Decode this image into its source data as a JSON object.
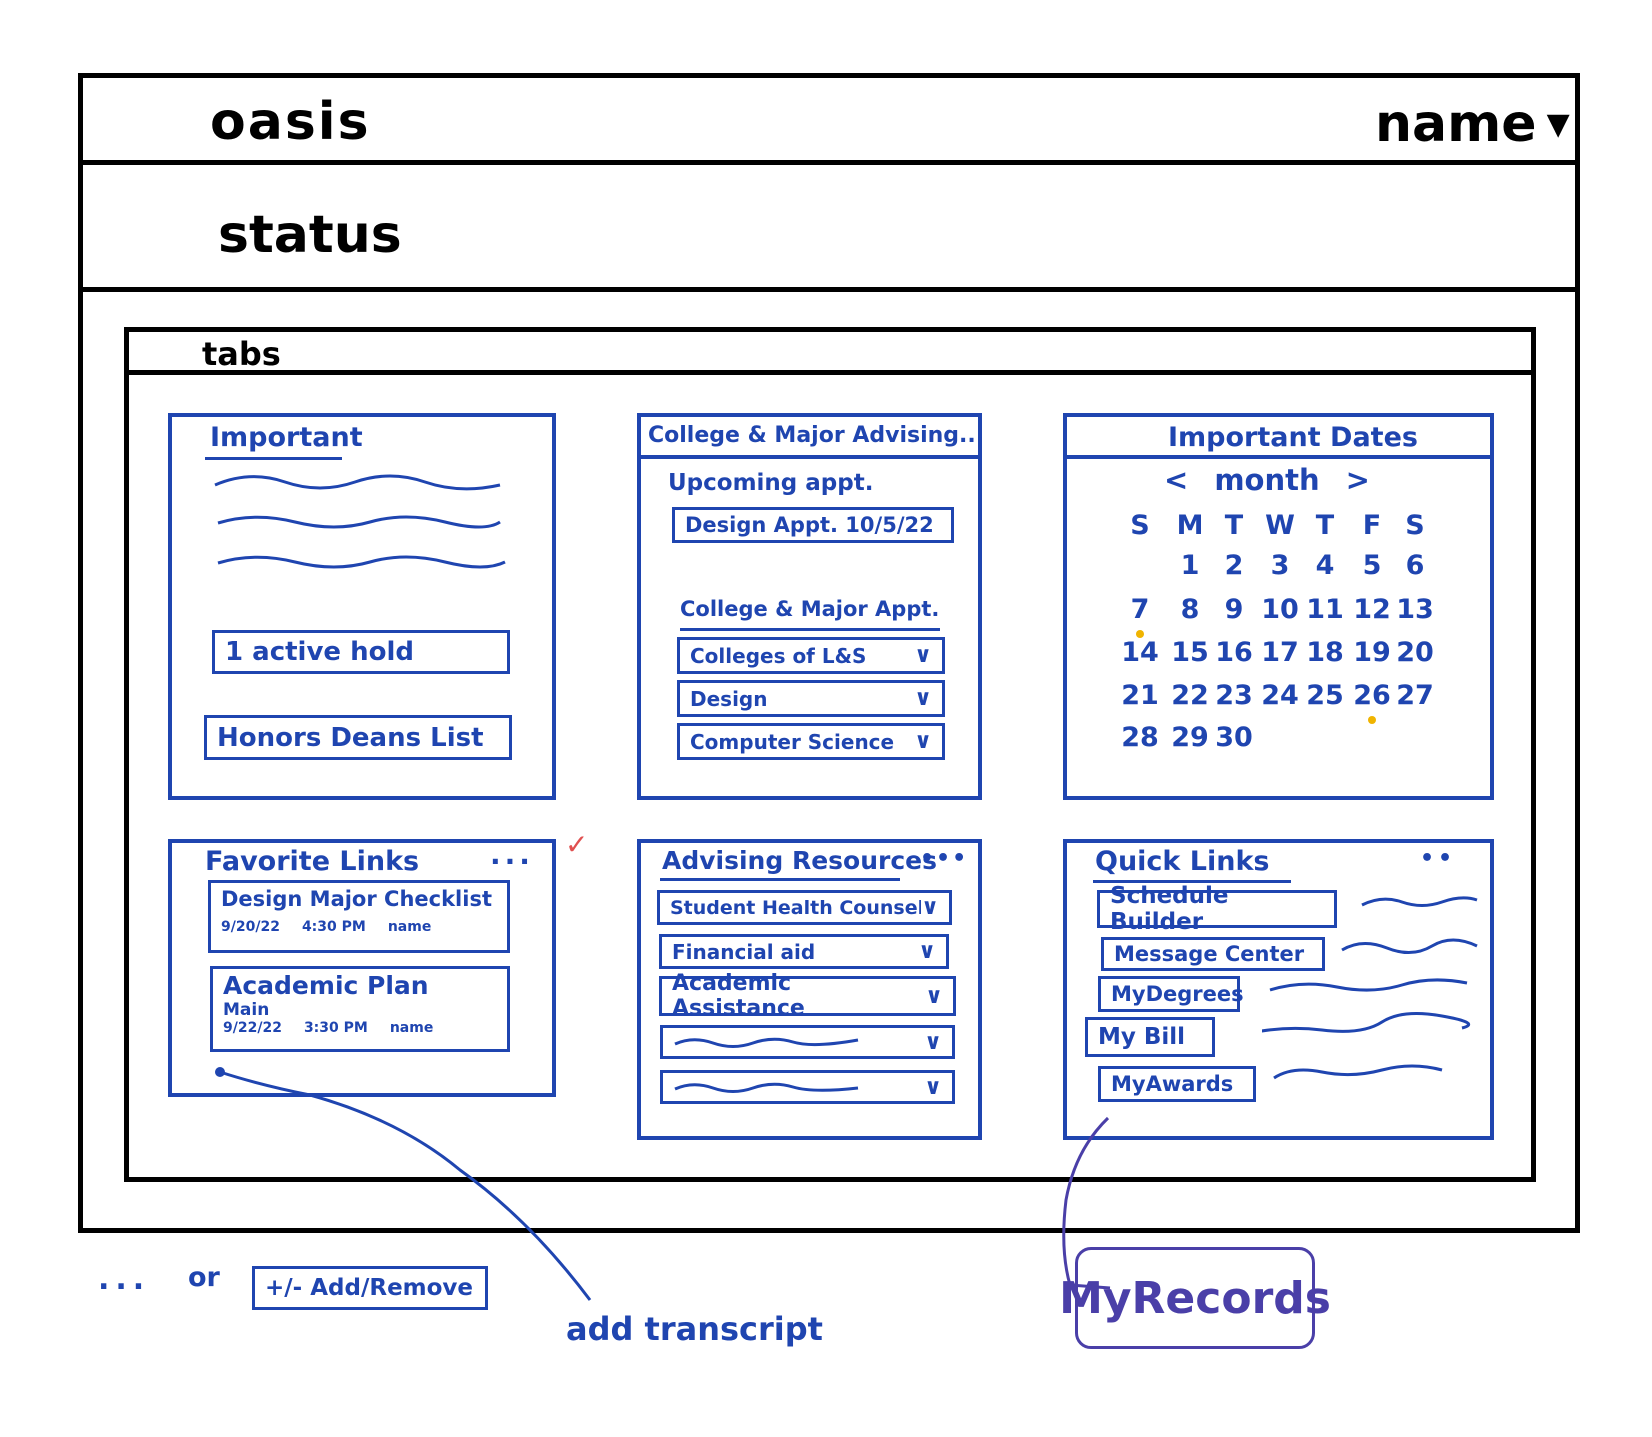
{
  "app": {
    "title": "oasis",
    "user_menu": "name"
  },
  "page": {
    "heading": "status",
    "tabs_label": "tabs"
  },
  "important": {
    "title": "Important",
    "items": [
      "1 active hold",
      "Honors Deans List"
    ]
  },
  "advising": {
    "title": "College & Major Advising...",
    "upcoming_label": "Upcoming appt.",
    "upcoming_appt": "Design Appt. 10/5/22",
    "appt_label": "College & Major Appt.",
    "options": [
      "Colleges of L&S",
      "Design",
      "Computer Science"
    ]
  },
  "dates": {
    "title": "Important Dates",
    "month_label": "month",
    "prev": "<",
    "next": ">",
    "weekdays": [
      "S",
      "M",
      "T",
      "W",
      "T",
      "F",
      "S"
    ],
    "weeks": [
      [
        "",
        "1",
        "2",
        "3",
        "4",
        "5",
        "6"
      ],
      [
        "7",
        "8",
        "9",
        "10",
        "11",
        "12",
        "13"
      ],
      [
        "14",
        "15",
        "16",
        "17",
        "18",
        "19",
        "20"
      ],
      [
        "21",
        "22",
        "23",
        "24",
        "25",
        "26",
        "27"
      ],
      [
        "28",
        "29",
        "30",
        "",
        "",
        "",
        ""
      ]
    ],
    "marked_days": [
      "7",
      "26"
    ],
    "marker_color": "#f0b400"
  },
  "favorites": {
    "title": "Favorite Links",
    "more": "...",
    "items": [
      {
        "title": "Design Major Checklist",
        "sub": "",
        "date": "9/20/22",
        "time": "4:30 PM",
        "author": "name"
      },
      {
        "title": "Academic Plan",
        "sub": "Main",
        "date": "9/22/22",
        "time": "3:30 PM",
        "author": "name"
      }
    ],
    "check_mark": "✓",
    "check_color": "#e05050"
  },
  "resources": {
    "title": "Advising Resources",
    "more": "•••",
    "items": [
      "Student Health Counseling",
      "Financial aid",
      "Academic Assistance",
      "",
      ""
    ]
  },
  "quick": {
    "title": "Quick Links",
    "more": "••",
    "items": [
      "Schedule Builder",
      "Message Center",
      "MyDegrees",
      "My Bill",
      "MyAwards"
    ]
  },
  "annotations": {
    "or_text": "or",
    "ellipsis": "...",
    "add_remove": "+/- Add/Remove",
    "add_transcript": "add transcript",
    "my_records": "MyRecords",
    "purple": "#4a3fa8"
  },
  "colors": {
    "ink": "#1f45b0",
    "frame": "#000000"
  }
}
